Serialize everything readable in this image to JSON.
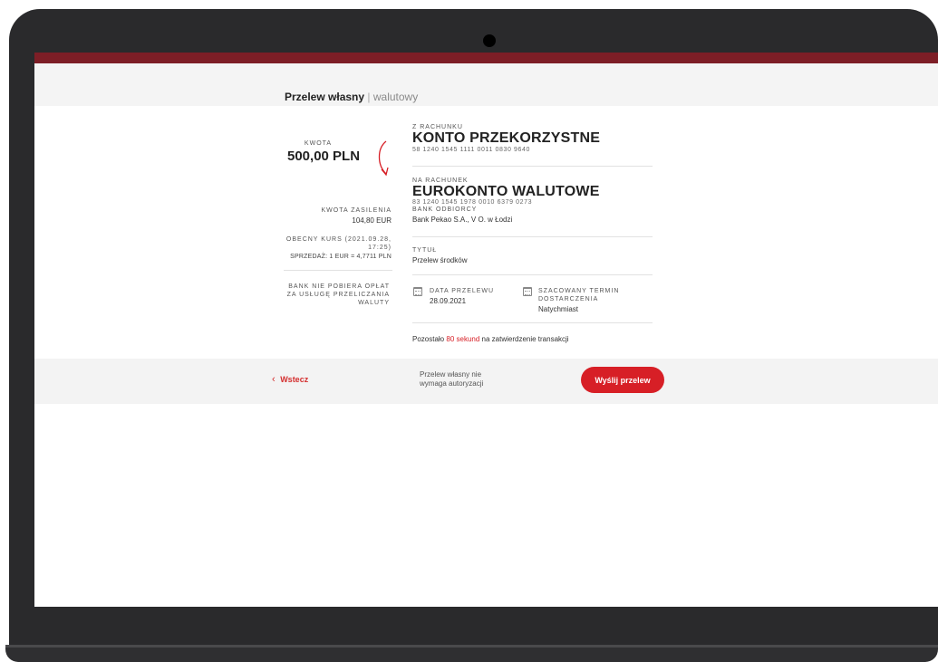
{
  "header": {
    "title_bold": "Przelew własny",
    "separator": "|",
    "title_light": "walutowy"
  },
  "transfer": {
    "amount_label": "KWOTA",
    "amount_value": "500,00 PLN",
    "topup_label": "KWOTA ZASILENIA",
    "topup_value": "104,80 EUR",
    "rate_label": "OBECNY KURS (2021.09.28, 17:25)",
    "rate_value": "SPRZEDAŻ: 1 EUR = 4,7711 PLN",
    "fee_note": "BANK NIE POBIERA OPŁAT ZA USŁUGĘ PRZELICZANIA WALUTY"
  },
  "from": {
    "label": "Z RACHUNKU",
    "name": "KONTO PRZEKORZYSTNE",
    "number": "58 1240 1545 1111 0011 0830 9640"
  },
  "to": {
    "label": "NA RACHUNEK",
    "name": "EUROKONTO WALUTOWE",
    "number": "83 1240 1545 1978 0010 6379 0273",
    "bank_label": "BANK ODBIORCY",
    "bank_value": "Bank Pekao S.A., V O. w Łodzi"
  },
  "title": {
    "label": "TYTUŁ",
    "value": "Przelew środków"
  },
  "dates": {
    "transfer_label": "DATA PRZELEWU",
    "transfer_value": "28.09.2021",
    "delivery_label_1": "SZACOWANY TERMIN",
    "delivery_label_2": "DOSTARCZENIA",
    "delivery_value": "Natychmiast"
  },
  "timer": {
    "prefix": "Pozostało",
    "highlight": "80 sekund",
    "suffix": "na zatwierdzenie transakcji"
  },
  "footer": {
    "back_label": "Wstecz",
    "note": "Przelew własny nie wymaga autoryzacji",
    "send_label": "Wyślij przelew"
  },
  "colors": {
    "brand_red": "#d71f26",
    "top_bar": "#7d1e26"
  },
  "icons": {
    "arrow": "curved-arrow-down-icon",
    "calendar": "calendar-icon",
    "back": "chevron-left-icon"
  }
}
